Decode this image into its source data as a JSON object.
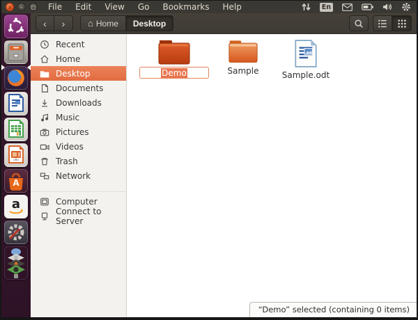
{
  "panel": {
    "menus": [
      "File",
      "Edit",
      "View",
      "Go",
      "Bookmarks",
      "Help"
    ],
    "window_controls": {
      "close": "x",
      "minimize": "–",
      "maximize": "□"
    },
    "indicators": {
      "keyboard": "En"
    }
  },
  "toolbar": {
    "back_glyph": "‹",
    "forward_glyph": "›",
    "home_glyph": "⌂",
    "breadcrumb": [
      {
        "label": "Home"
      },
      {
        "label": "Desktop"
      }
    ]
  },
  "sidebar": {
    "items": [
      {
        "label": "Recent"
      },
      {
        "label": "Home"
      },
      {
        "label": "Desktop",
        "selected": true
      },
      {
        "label": "Documents"
      },
      {
        "label": "Downloads"
      },
      {
        "label": "Music"
      },
      {
        "label": "Pictures"
      },
      {
        "label": "Videos"
      },
      {
        "label": "Trash"
      },
      {
        "label": "Network"
      },
      {
        "label": "Computer"
      },
      {
        "label": "Connect to Server"
      }
    ]
  },
  "main": {
    "files": [
      {
        "name": "Demo",
        "type": "folder",
        "selected": true,
        "renaming": true
      },
      {
        "name": "Sample",
        "type": "folder"
      },
      {
        "name": "Sample.odt",
        "type": "writer-document"
      }
    ],
    "rename_value": "Demo"
  },
  "statusbar": {
    "text": "“Demo” selected  (containing 0 items)"
  },
  "launcher": {
    "items": [
      "ubuntu-dash",
      "files",
      "firefox",
      "libreoffice-writer",
      "libreoffice-calc",
      "libreoffice-impress",
      "ubuntu-software-center",
      "amazon",
      "system-settings",
      "workspace-stack"
    ],
    "glyphs": {
      "amazon": "a",
      "software_center": "A"
    }
  },
  "colors": {
    "accent": "#E8764F",
    "panel_bg": "#3A3833",
    "sidebar_bg": "#F4F2EF",
    "launcher_bg": "#32142A",
    "selection": "#E8764F"
  }
}
